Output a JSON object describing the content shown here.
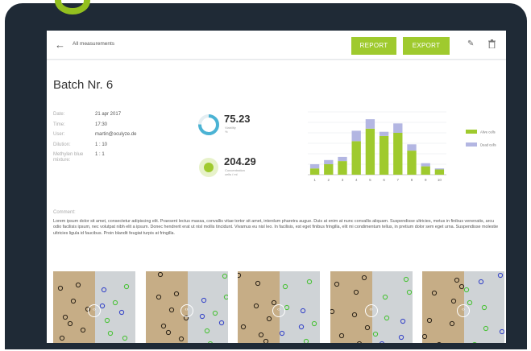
{
  "colors": {
    "accent": "#9fca2e",
    "viable": "#9fca2e",
    "dead": "#b3b6e2",
    "frame": "#1f2a36"
  },
  "header": {
    "back_icon": "arrow-left-icon",
    "breadcrumb": "All measurements",
    "report_label": "REPORT",
    "export_label": "EXPORT",
    "edit_icon": "pencil-icon",
    "delete_icon": "trash-icon"
  },
  "page": {
    "title": "Batch Nr. 6"
  },
  "meta": [
    {
      "label": "Date:",
      "value": "21 apr 2017"
    },
    {
      "label": "Time:",
      "value": "17:30"
    },
    {
      "label": "User:",
      "value": "martin@oculyze.de"
    },
    {
      "label": "Dilution:",
      "value": "1 : 10"
    },
    {
      "label": "Methylen blue mixture:",
      "value": "1 : 1"
    }
  ],
  "stats": {
    "viability": {
      "value": "75.23",
      "label": "Viability",
      "unit": "%",
      "fraction": 0.7523
    },
    "concentration": {
      "value": "204.29",
      "label": "Concentration",
      "unit": "cells / ml"
    }
  },
  "chart_data": {
    "type": "bar",
    "categories": [
      "1",
      "2",
      "3",
      "4",
      "5",
      "6",
      "7",
      "8",
      "9",
      "10"
    ],
    "series": [
      {
        "name": "Alive cells",
        "values": [
          6,
          10,
          13,
          32,
          44,
          37,
          40,
          23,
          8,
          5
        ]
      },
      {
        "name": "Dead cells",
        "values": [
          4,
          4,
          4,
          10,
          9,
          4,
          9,
          6,
          3,
          1
        ]
      }
    ],
    "stacked": true,
    "ylim": [
      0,
      60
    ],
    "grid": true,
    "legend": "right"
  },
  "comment": {
    "label": "Comment:",
    "text": "Lorem ipsum dolor sit amet, consectetur adipiscing elit. Praesent lectus massa, convallis vitae tortor sit amet, interdum pharetra augue. Duis at enim at nunc convallis aliquam. Suspendisse ultricies, metus in finibus venenatis, arcu odio facilisis ipsum, nec volutpat nibh elit a ipsum. Donec hendrerit erat ut nisl mollis tincidunt. Vivamus eu nisl leo. In facilisis, est eget finibus fringilla, elit mi condimentum tellus, in pretium dolor sem eget urna. Suspendisse molestie ultricies ligula id faucibus. Proin blandit feugiat turpis at fringilla."
  },
  "thumbnails": [
    {
      "handle_icon": "compare-slider-icon"
    },
    {
      "handle_icon": "compare-slider-icon"
    },
    {
      "handle_icon": "compare-slider-icon"
    },
    {
      "handle_icon": "compare-slider-icon"
    },
    {
      "handle_icon": "compare-slider-icon"
    }
  ]
}
